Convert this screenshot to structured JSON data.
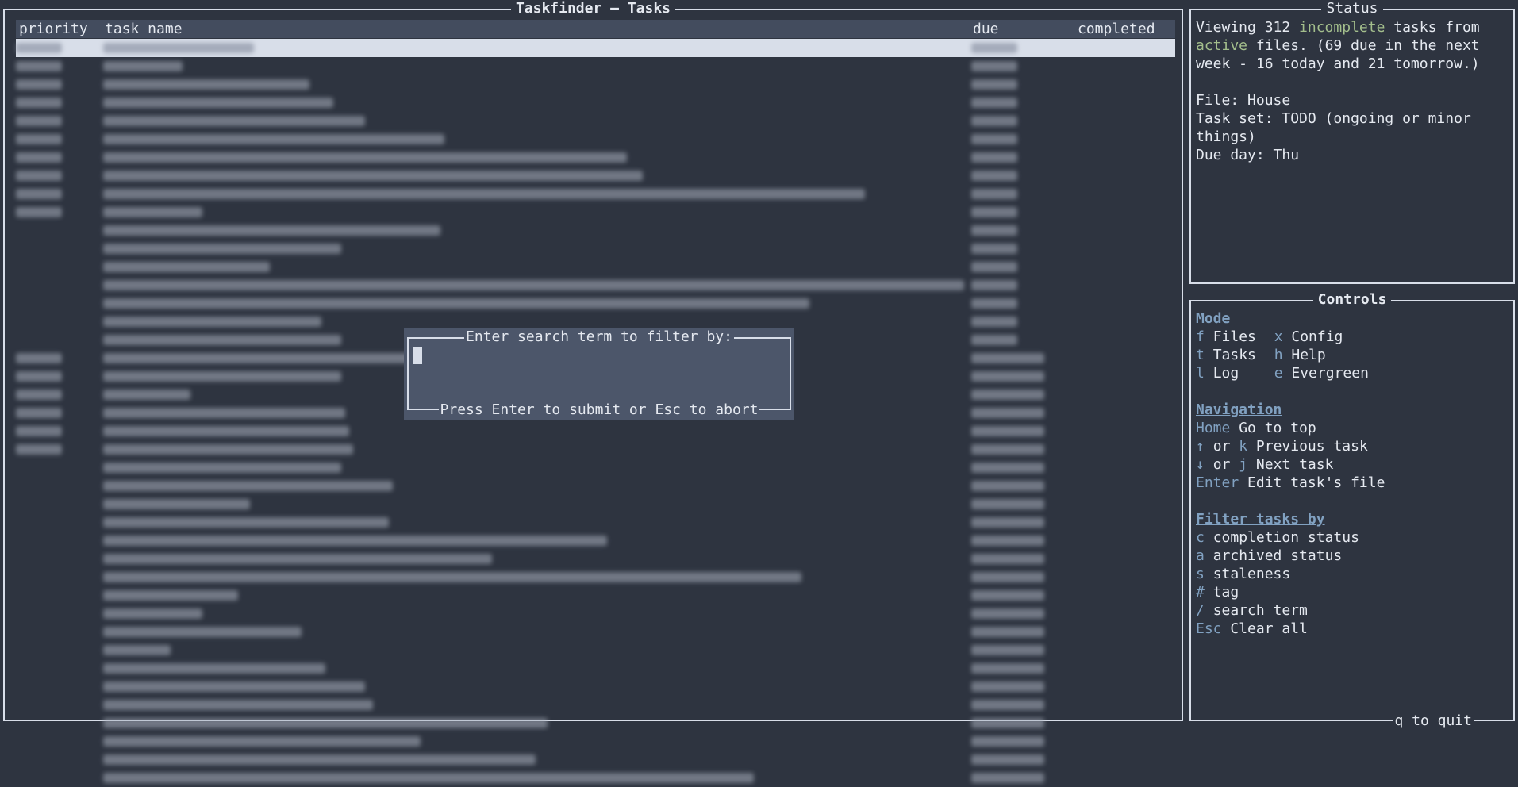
{
  "tasks_panel": {
    "title": "Taskfinder – Tasks",
    "columns": [
      "priority",
      "task name",
      "due",
      "completed"
    ]
  },
  "status_panel": {
    "title": "Status",
    "viewing_prefix": "Viewing 312 ",
    "viewing_highlight": "incomplete",
    "viewing_mid": " tasks from ",
    "viewing_highlight2": "active",
    "viewing_suffix": " files. (69 due in the next week - 16 today and 21 tomorrow.)",
    "file_line": "File: House",
    "taskset_line": "Task set: TODO (ongoing or minor things)",
    "due_line": "Due day: Thu"
  },
  "controls_panel": {
    "title": "Controls",
    "mode_heading": "Mode",
    "mode_items": [
      {
        "key": "f",
        "label": "Files",
        "key2": "x",
        "label2": "Config"
      },
      {
        "key": "t",
        "label": "Tasks",
        "key2": "h",
        "label2": "Help"
      },
      {
        "key": "l",
        "label": "Log",
        "key2": "e",
        "label2": "Evergreen"
      }
    ],
    "nav_heading": "Navigation",
    "nav_items": [
      {
        "key": "Home",
        "label": "Go to top"
      },
      {
        "key": "↑",
        "mid": "or",
        "key2": "k",
        "label": "Previous task"
      },
      {
        "key": "↓",
        "mid": "or",
        "key2": "j",
        "label": "Next task"
      },
      {
        "key": "Enter",
        "label": "Edit task's file"
      }
    ],
    "filter_heading": "Filter tasks by",
    "filter_items": [
      {
        "key": "c",
        "label": "completion status"
      },
      {
        "key": "a",
        "label": "archived status"
      },
      {
        "key": "s",
        "label": "staleness"
      },
      {
        "key": "#",
        "label": "tag"
      },
      {
        "key": "/",
        "label": "search term"
      },
      {
        "key": "Esc",
        "label": "Clear all"
      }
    ],
    "quit_label": "q to quit"
  },
  "search_dialog": {
    "title": "Enter search term to filter by:",
    "value": "",
    "footer": "Press Enter to submit or Esc to abort"
  }
}
